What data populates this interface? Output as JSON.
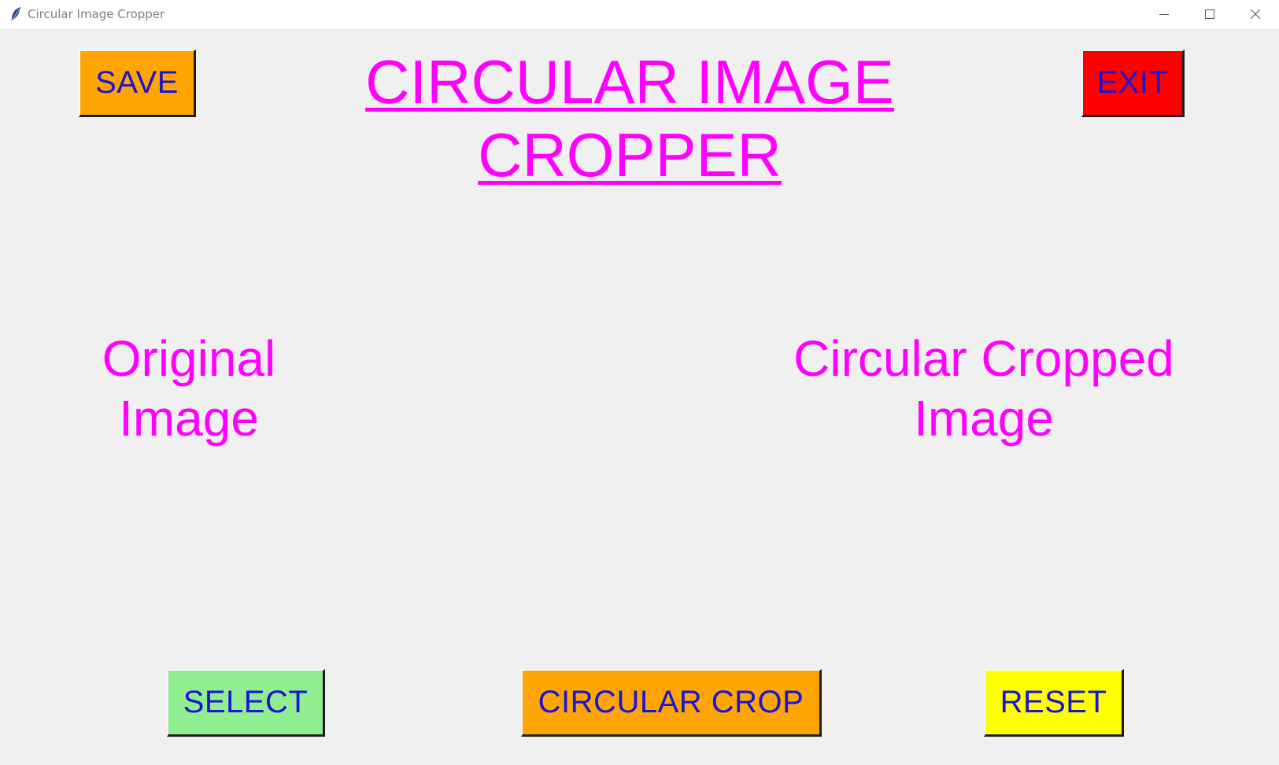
{
  "window": {
    "title": "Circular Image Cropper",
    "controls": [
      "minimize-icon",
      "maximize-icon",
      "close-icon"
    ]
  },
  "header": {
    "title": "CIRCULAR IMAGE CROPPER",
    "save_label": "SAVE",
    "exit_label": "EXIT"
  },
  "panels": {
    "original_label": "Original Image",
    "cropped_label": "Circular Cropped Image"
  },
  "footer": {
    "select_label": "SELECT",
    "crop_label": "CIRCULAR CROP",
    "reset_label": "RESET"
  },
  "colors": {
    "background": "#f0f0f0",
    "heading": "#ff00ff",
    "button_text": "#1a14d6",
    "save": "#ffa500",
    "exit": "#ff0000",
    "select": "#90ee90",
    "crop": "#ffa500",
    "reset": "#ffff00"
  }
}
